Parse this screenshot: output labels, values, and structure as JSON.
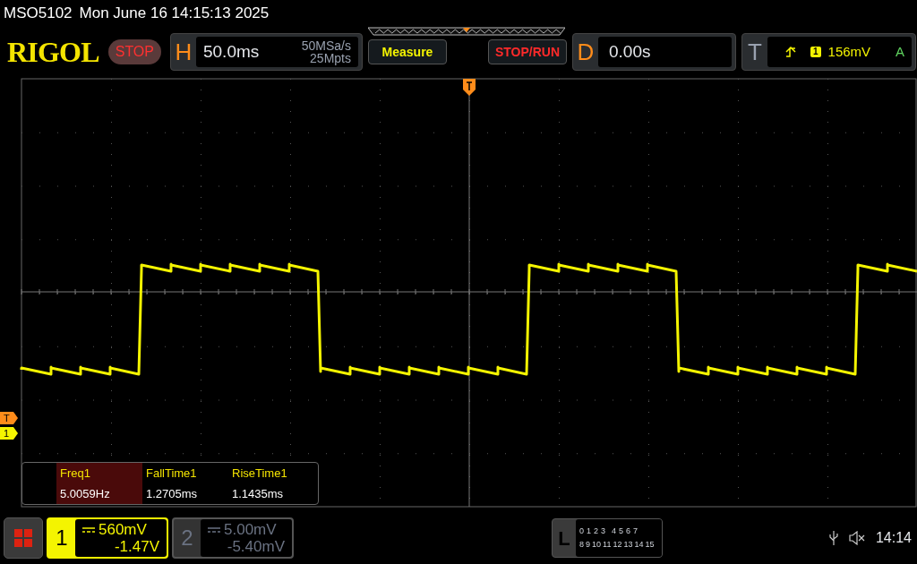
{
  "title_bar": {
    "model": "MSO5102",
    "datetime": "Mon June 16 14:15:13 2025"
  },
  "toolbar": {
    "logo": "RIGOL",
    "run_state": "STOP",
    "horizontal": {
      "label": "H",
      "timebase": "50.0ms",
      "sample_rate": "50MSa/s",
      "memory_depth": "25Mpts"
    },
    "buttons": [
      {
        "label": "Measure",
        "kind": "measure"
      },
      {
        "label": "STOP/RUN",
        "kind": "stoprun"
      }
    ],
    "delay": {
      "label": "D",
      "value": "0.00s"
    },
    "trigger": {
      "label": "T",
      "channel": "1",
      "level": "156mV",
      "mode": "A"
    }
  },
  "markers": [
    {
      "label": "T",
      "kind": "trigger"
    },
    {
      "label": "1",
      "kind": "channel"
    }
  ],
  "measurements": [
    {
      "name": "Freq1",
      "value": "5.0059Hz",
      "selected": true
    },
    {
      "name": "FallTime1",
      "value": "1.2705ms",
      "selected": false
    },
    {
      "name": "RiseTime1",
      "value": "1.1435ms",
      "selected": false
    }
  ],
  "channels": [
    {
      "number": "1",
      "scale": "560mV",
      "offset": "-1.47V",
      "on": true
    },
    {
      "number": "2",
      "scale": "5.00mV",
      "offset": "-5.40mV",
      "on": false
    }
  ],
  "logic": {
    "label": "L",
    "row_1": [
      "0",
      "1",
      "2",
      "3",
      "4",
      "5",
      "6",
      "7"
    ],
    "row_2": [
      "8",
      "9",
      "10",
      "11",
      "12",
      "13",
      "14",
      "15"
    ]
  },
  "status": {
    "time": "14:14"
  }
}
